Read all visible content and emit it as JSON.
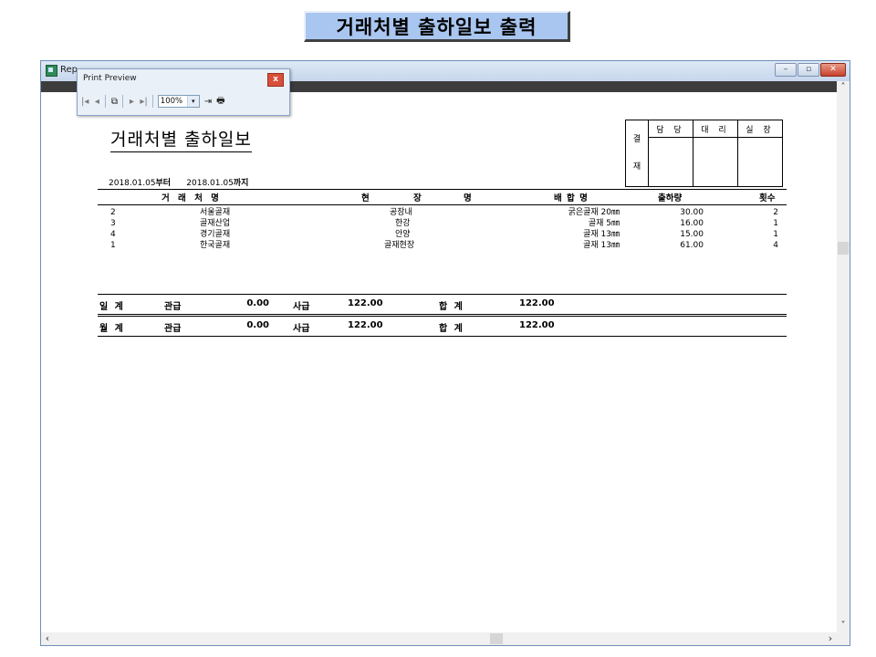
{
  "banner": "거래처별 출하일보 출력",
  "window": {
    "title": "Rep"
  },
  "print_preview": {
    "title": "Print Preview",
    "close": "x",
    "zoom": "100%",
    "icons": [
      "first-page-icon",
      "prev-page-icon",
      "copy-icon",
      "next-page-icon",
      "last-page-icon",
      "exit-icon",
      "print-icon"
    ]
  },
  "report": {
    "title": "거래처별 출하일보",
    "date_from": "2018.01.05",
    "from_suffix": "부터",
    "date_to": "2018.01.05",
    "to_suffix": "까지",
    "approval": {
      "side_top": "결",
      "side_bottom": "재",
      "heads": [
        "담 당",
        "대 리",
        "실 장"
      ]
    },
    "columns": [
      "거 래 처 명",
      "현 장 명",
      "배 합 명",
      "출하량",
      "횟수"
    ],
    "site_col_parts": [
      "현",
      "장",
      "명"
    ],
    "rows": [
      {
        "code": "2",
        "client": "서울골재",
        "site": "공장내",
        "mix": "굵은골재 20㎜",
        "qty": "30.00",
        "count": "2"
      },
      {
        "code": "3",
        "client": "골재산업",
        "site": "한강",
        "mix": "골재 5㎜",
        "qty": "16.00",
        "count": "1"
      },
      {
        "code": "4",
        "client": "경기골재",
        "site": "안양",
        "mix": "골재 13㎜",
        "qty": "15.00",
        "count": "1"
      },
      {
        "code": "1",
        "client": "한국골재",
        "site": "골재현장",
        "mix": "골재 13㎜",
        "qty": "61.00",
        "count": "4"
      }
    ],
    "daily": {
      "label": "일 계",
      "official_label": "관급",
      "official": "0.00",
      "private_label": "사급",
      "private": "122.00",
      "total_label": "합 계",
      "total": "122.00"
    },
    "monthly": {
      "label": "월 계",
      "official_label": "관급",
      "official": "0.00",
      "private_label": "사급",
      "private": "122.00",
      "total_label": "합 계",
      "total": "122.00"
    }
  }
}
